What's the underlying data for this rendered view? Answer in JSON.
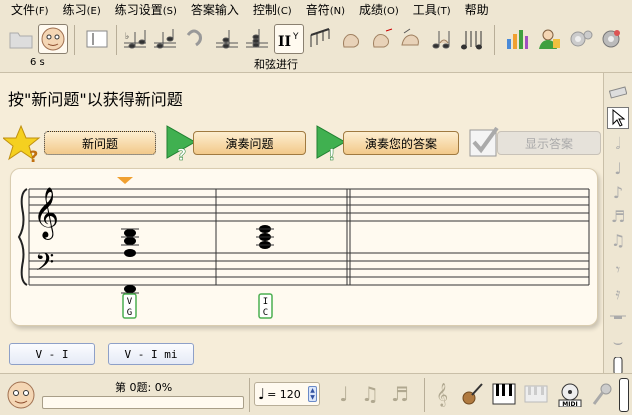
{
  "menubar": {
    "items": [
      {
        "label": "文件",
        "accel": "(F)"
      },
      {
        "label": "练习",
        "accel": "(E)"
      },
      {
        "label": "练习设置",
        "accel": "(S)"
      },
      {
        "label": "答案输入",
        "accel": ""
      },
      {
        "label": "控制",
        "accel": "(C)"
      },
      {
        "label": "音符",
        "accel": "(N)"
      },
      {
        "label": "成绩",
        "accel": "(O)"
      },
      {
        "label": "工具",
        "accel": "(T)"
      },
      {
        "label": "帮助",
        "accel": ""
      }
    ]
  },
  "toolbar": {
    "exercise_time": "6 s",
    "exercise_name": "和弦进行",
    "active_tool_text": "II"
  },
  "instruction": "按\"新问题\"以获得新问题",
  "actions": {
    "new_question": "新问题",
    "play_question": "演奏问题",
    "play_answer": "演奏您的答案",
    "show_answer": "显示答案"
  },
  "staff": {
    "chord_labels": [
      {
        "top": "V",
        "bottom": "G"
      },
      {
        "top": "I",
        "bottom": "C"
      }
    ]
  },
  "answers": {
    "buttons": [
      "V - I",
      "V - I mi"
    ]
  },
  "status": {
    "score": "第 0题: 0%",
    "progress_percent": 0,
    "tempo": "= 120"
  },
  "colors": {
    "accent_orange": "#f0a030",
    "panel_bg": "#eee6d2",
    "content_bg": "#f6edd9",
    "label_box_green": "#4caf50"
  }
}
